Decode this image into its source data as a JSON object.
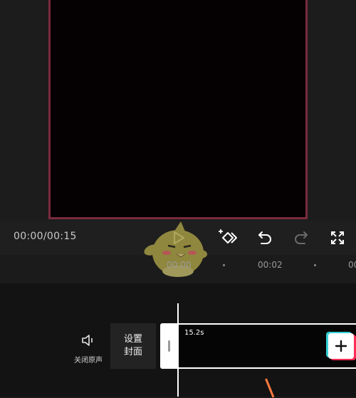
{
  "player": {
    "time": "00:00/00:15",
    "current_time": "00:00",
    "total_time": "00:15"
  },
  "toolbar": {
    "icons": [
      "play-icon",
      "keyframe-add-icon",
      "undo-icon",
      "redo-icon",
      "fullscreen-icon"
    ]
  },
  "timeline": {
    "ticks": [
      {
        "label": "00:00"
      },
      {
        "label": "00:02"
      },
      {
        "label": "00"
      }
    ]
  },
  "tracks": {
    "mute_label": "关闭原声",
    "cover_line1": "设置",
    "cover_line2": "封面",
    "clip_duration": "15.2s"
  },
  "colors": {
    "frame_border": "#7a2a3c",
    "accent_cyan": "#35d0d6",
    "accent_red": "#ff2d55",
    "audio_line": "#ff7a3d"
  }
}
